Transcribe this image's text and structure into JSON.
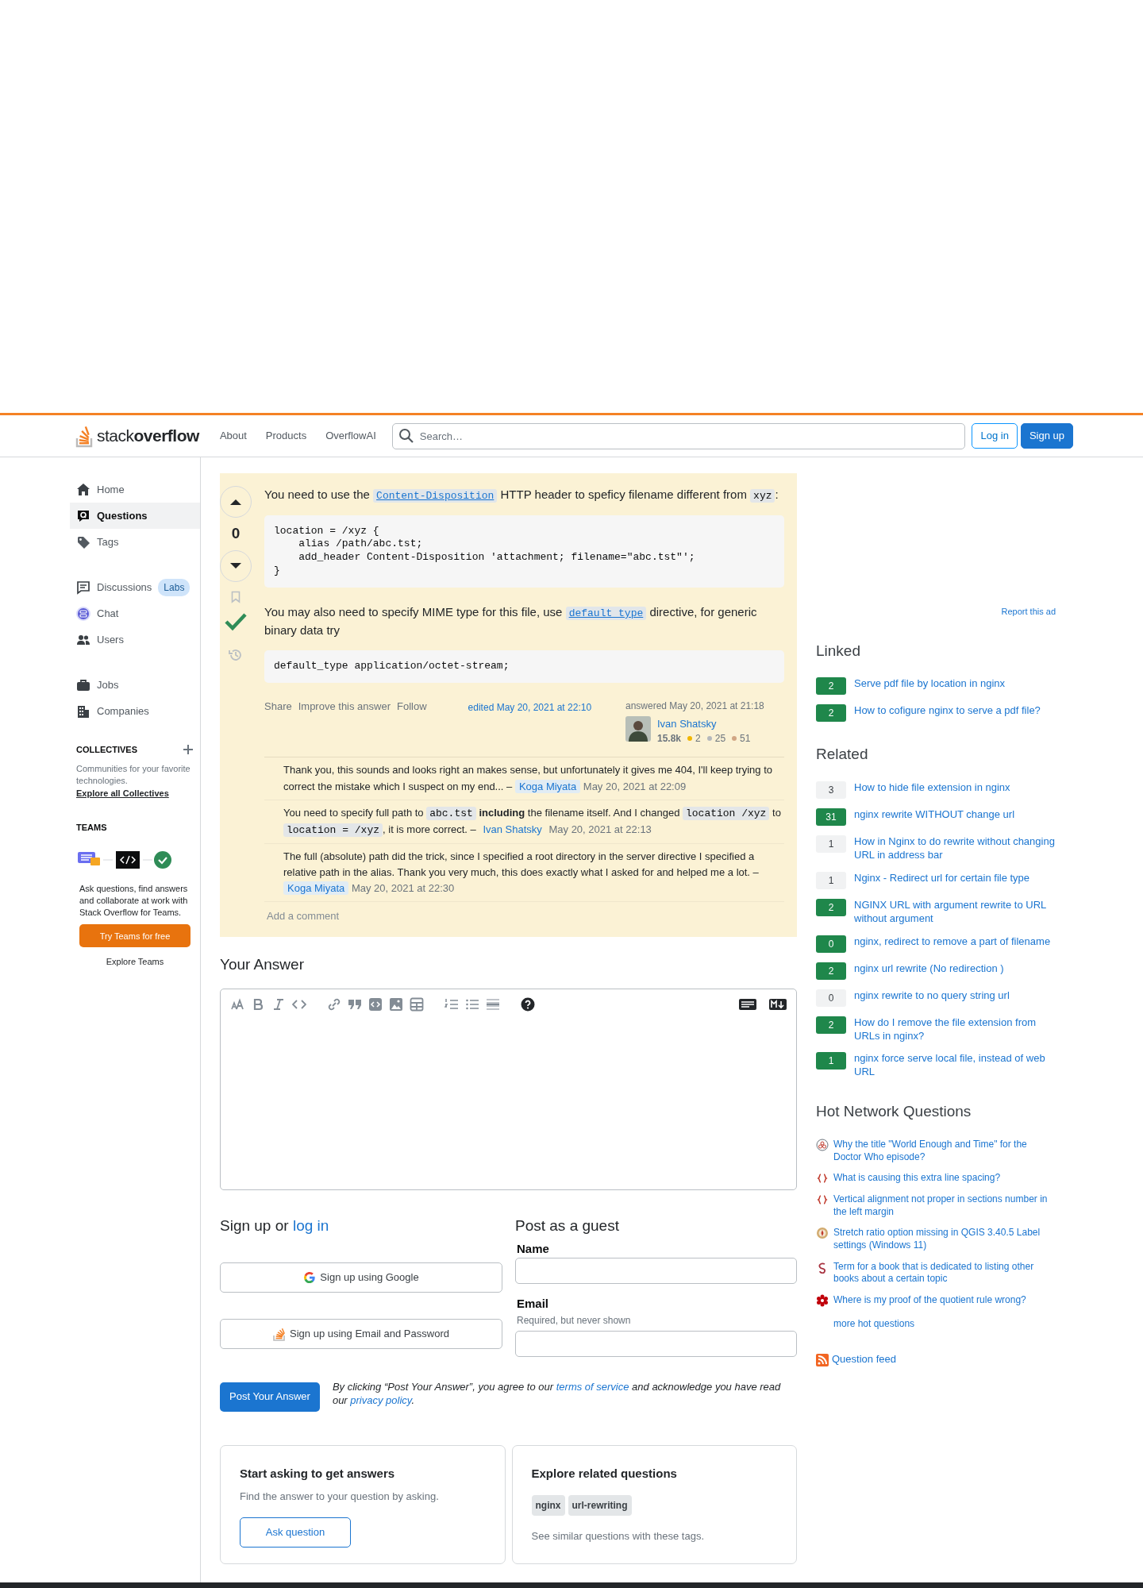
{
  "header": {
    "logo": "stack**overflow**",
    "nav": [
      "About",
      "Products",
      "OverflowAI"
    ],
    "search": {
      "placeholder": "Search…"
    },
    "buttons": [
      {
        "label": "Log in",
        "kind": "outline"
      },
      {
        "label": "Sign up",
        "kind": "primary"
      }
    ]
  },
  "sidebar": {
    "groups": [
      [
        {
          "label": "Home",
          "selected": false
        },
        {
          "label": "Questions",
          "selected": true
        },
        {
          "label": "Tags",
          "selected": false
        }
      ],
      [
        {
          "label": "Discussions",
          "selected": false,
          "tag": "Labs"
        },
        {
          "label": "Chat",
          "selected": false
        },
        {
          "label": "Users",
          "selected": false
        }
      ],
      [
        {
          "label": "Jobs",
          "selected": false
        },
        {
          "label": "Companies",
          "selected": false
        }
      ]
    ],
    "collectives": {
      "title": "COLLECTIVES",
      "text": "Communities for your favorite technologies.",
      "link": "Explore all Collectives"
    },
    "teams": {
      "title": "TEAMS",
      "text": "Ask questions, find answers and collaborate at work with Stack Overflow for Teams.",
      "button": "Try Teams for free",
      "link": "Explore Teams"
    }
  },
  "answer": {
    "score": "0",
    "accepted": true,
    "bookmarked": false,
    "body": [
      {
        "kind": "paragraph",
        "parts": [
          {
            "kind": "text",
            "text": "You need to use the "
          },
          {
            "kind": "code-link",
            "text": "Content-Disposition"
          },
          {
            "kind": "text",
            "text": " HTTP header to speficy filename different from "
          },
          {
            "kind": "code",
            "text": "xyz"
          },
          {
            "kind": "text",
            "text": ":"
          }
        ]
      },
      {
        "kind": "code",
        "text": "location = /xyz {\n    alias /path/abc.tst;\n    add_header Content-Disposition 'attachment; filename=\"abc.tst\"';\n}"
      },
      {
        "kind": "paragraph",
        "parts": [
          {
            "kind": "text",
            "text": "You may also need to specify MIME type for this file, use "
          },
          {
            "kind": "code-link",
            "text": "default_type"
          },
          {
            "kind": "text",
            "text": " directive, for generic binary data try"
          }
        ]
      },
      {
        "kind": "code",
        "text": "default_type application/octet-stream;"
      }
    ],
    "menu": [
      "Share",
      "Improve this answer",
      "Follow"
    ],
    "edited": "edited May 20, 2021 at 22:10",
    "answered": "answered May 20, 2021 at 21:18",
    "user": {
      "name": "Ivan Shatsky",
      "reputation": "15.8k",
      "badges": [
        {
          "count": "2",
          "color": "#f1b600"
        },
        {
          "count": "25",
          "color": "#b4b8bc"
        },
        {
          "count": "51",
          "color": "#d1a684"
        }
      ]
    },
    "comments": [
      {
        "parts": [
          {
            "kind": "text",
            "text": "Thank you, this sounds and looks right an makes sense, but unfortunately it gives me 404, I'll keep trying to correct the mistake which I suspect on my end... –"
          }
        ],
        "author": "Koga Miyata",
        "highlighted": true,
        "date": "May 20, 2021 at 22:09"
      },
      {
        "parts": [
          {
            "kind": "text",
            "text": "You need to specify full path to "
          },
          {
            "kind": "code",
            "text": "abc.tst"
          },
          {
            "kind": "text",
            "text": " **including** the filename itself. And I changed "
          },
          {
            "kind": "code",
            "text": "location /xyz"
          },
          {
            "kind": "text",
            "text": " to "
          },
          {
            "kind": "code",
            "text": "location = /xyz"
          },
          {
            "kind": "text",
            "text": ", it is more correct. –"
          }
        ],
        "author": "Ivan Shatsky",
        "highlighted": false,
        "date": "May 20, 2021 at 22:13"
      },
      {
        "parts": [
          {
            "kind": "text",
            "text": "The full (absolute) path did the trick, since I specified a root directory in the server directive I specified a relative path in the alias. Thank you very much, this does exactly what I asked for and helped me a lot. –"
          }
        ],
        "author": "Koga Miyata",
        "highlighted": true,
        "date": "May 20, 2021 at 22:30"
      }
    ],
    "add_comment": "Add a comment"
  },
  "your_answer": {
    "title": "Your Answer"
  },
  "signup": {
    "title": "Sign up or ",
    "title_link": "log in",
    "buttons": [
      "Sign up using Google",
      "Sign up using Email and Password"
    ]
  },
  "guest": {
    "title": "Post as a guest",
    "fields": [
      {
        "label": "Name"
      },
      {
        "label": "Email",
        "hint": "Required, but never shown"
      }
    ]
  },
  "post": {
    "button": "Post Your Answer",
    "notice": [
      {
        "kind": "text",
        "text": "By clicking “Post Your Answer”, you agree to our "
      },
      {
        "kind": "link",
        "text": "terms of service"
      },
      {
        "kind": "text",
        "text": " and acknowledge you have read our "
      },
      {
        "kind": "link",
        "text": "privacy policy"
      },
      {
        "kind": "text",
        "text": "."
      }
    ]
  },
  "ask_card": {
    "title": "Start asking to get answers",
    "text": "Find the answer to your question by asking.",
    "button": "Ask question"
  },
  "explore_card": {
    "title": "Explore related questions",
    "tags": [
      "nginx",
      "url-rewriting"
    ],
    "text": "See similar questions with these tags."
  },
  "right": {
    "report": "Report this ad",
    "linked": {
      "title": "Linked",
      "items": [
        {
          "score": "2",
          "answered": true,
          "title": "Serve pdf file by location in nginx"
        },
        {
          "score": "2",
          "answered": true,
          "title": "How to cofigure nginx to serve a pdf file?"
        }
      ]
    },
    "related": {
      "title": "Related",
      "items": [
        {
          "score": "3",
          "answered": false,
          "title": "How to hide file extension in nginx"
        },
        {
          "score": "31",
          "answered": true,
          "title": "nginx rewrite WITHOUT change url"
        },
        {
          "score": "1",
          "answered": false,
          "title": "How in Nginx to do rewrite without changing URL in address bar"
        },
        {
          "score": "1",
          "answered": false,
          "title": "Nginx - Redirect url for certain file type"
        },
        {
          "score": "2",
          "answered": true,
          "title": "NGINX URL with argument rewrite to URL without argument"
        },
        {
          "score": "0",
          "answered": true,
          "title": "nginx, redirect to remove a part of filename"
        },
        {
          "score": "2",
          "answered": true,
          "title": "nginx url rewrite (No redirection )"
        },
        {
          "score": "0",
          "answered": false,
          "title": "nginx rewrite to no query string url"
        },
        {
          "score": "2",
          "answered": true,
          "title": "How do I remove the file extension from URLs in nginx?"
        },
        {
          "score": "1",
          "answered": true,
          "title": "nginx force serve local file, instead of web URL"
        }
      ]
    },
    "hot": {
      "title": "Hot Network Questions",
      "items": [
        "Why the title \"World Enough and Time\" for the Doctor Who episode?",
        "What is causing this extra line spacing?",
        "Vertical alignment not proper in sections number in the left margin",
        "Stretch ratio option missing in QGIS 3.40.5 Label settings (Windows 11)",
        "Term for a book that is dedicated to listing other books about a certain topic",
        "Where is my proof of the quotient rule wrong?"
      ],
      "more": "more hot questions"
    },
    "feed": "Question feed"
  }
}
